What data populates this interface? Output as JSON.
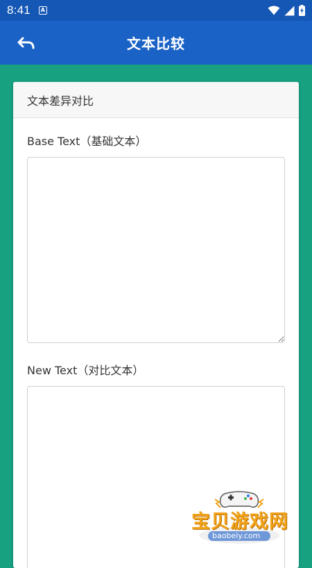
{
  "status_bar": {
    "time": "8:41",
    "notification_glyph": "A",
    "icons": [
      "wifi-icon",
      "cell-signal-icon",
      "battery-charging-icon"
    ]
  },
  "app_bar": {
    "title": "文本比较",
    "back_icon": "undo-arrow-icon",
    "color": "#1a62c6"
  },
  "card": {
    "header": "文本差异对比",
    "base_label": "Base Text（基础文本）",
    "base_value": "",
    "new_label": "New Text（对比文本）",
    "new_value": ""
  },
  "watermark": {
    "text": "宝贝游戏网",
    "url": "baobeiy.com"
  },
  "colors": {
    "status_bar": "#1557b4",
    "background": "#17a181",
    "card": "#ffffff",
    "card_header": "#f7f7f7"
  }
}
